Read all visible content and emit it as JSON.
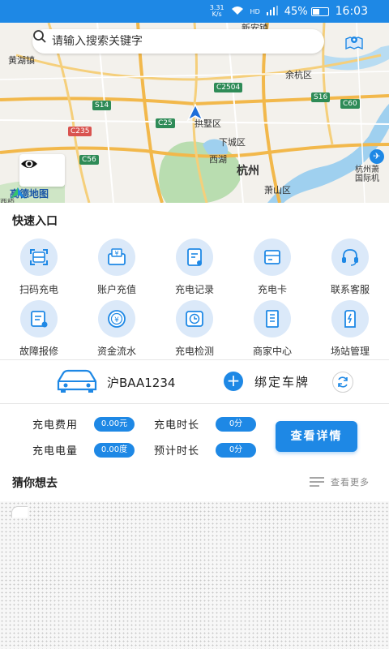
{
  "status_bar": {
    "net_speed_value": "3.31",
    "net_speed_unit": "K/s",
    "signal_label": "HD",
    "battery_text": "45%",
    "battery_level": 0.45,
    "time": "16:03"
  },
  "map": {
    "search_placeholder": "请输入搜索关键字",
    "logo_text": "高德地图",
    "labels": {
      "town_left": "黄湖镇",
      "top_center": "新安镇",
      "yuhang": "余杭区",
      "gongshu": "拱墅区",
      "xiacheng": "下城区",
      "xihu": "西湖",
      "hangzhou": "杭州",
      "xiaoshan": "萧山区",
      "airport": "杭州萧\n国际机",
      "corner_left": "西桥"
    },
    "road_badges": {
      "c2504": "C2504",
      "s14": "S14",
      "s16": "S16",
      "c60": "C60",
      "c235": "C235",
      "c25": "C25",
      "c56": "C56"
    }
  },
  "quick_entry": {
    "title": "快速入口",
    "rows": [
      [
        {
          "label": "扫码充电",
          "icon": "scan-icon"
        },
        {
          "label": "账户充值",
          "icon": "wallet-yen-icon"
        },
        {
          "label": "充电记录",
          "icon": "record-icon"
        },
        {
          "label": "充电卡",
          "icon": "card-icon"
        },
        {
          "label": "联系客服",
          "icon": "headset-icon"
        }
      ],
      [
        {
          "label": "故障报修",
          "icon": "repair-icon"
        },
        {
          "label": "资金流水",
          "icon": "money-flow-icon"
        },
        {
          "label": "充电检测",
          "icon": "clock-icon"
        },
        {
          "label": "商家中心",
          "icon": "merchant-icon"
        },
        {
          "label": "场站管理",
          "icon": "station-icon"
        }
      ]
    ]
  },
  "plate": {
    "number": "沪BAA1234",
    "bind_label": "绑定车牌"
  },
  "charging": {
    "fee_label": "充电费用",
    "fee_value": "0.00元",
    "duration_label": "充电时长",
    "duration_value": "0分",
    "energy_label": "充电电量",
    "energy_value": "0.00度",
    "estimated_label": "预计时长",
    "estimated_value": "0分",
    "detail_button": "查看详情"
  },
  "guess": {
    "title": "猜你想去",
    "more_label": "查看更多"
  },
  "colors": {
    "accent": "#1e88e5",
    "icon_bg": "#dbe9f9"
  }
}
